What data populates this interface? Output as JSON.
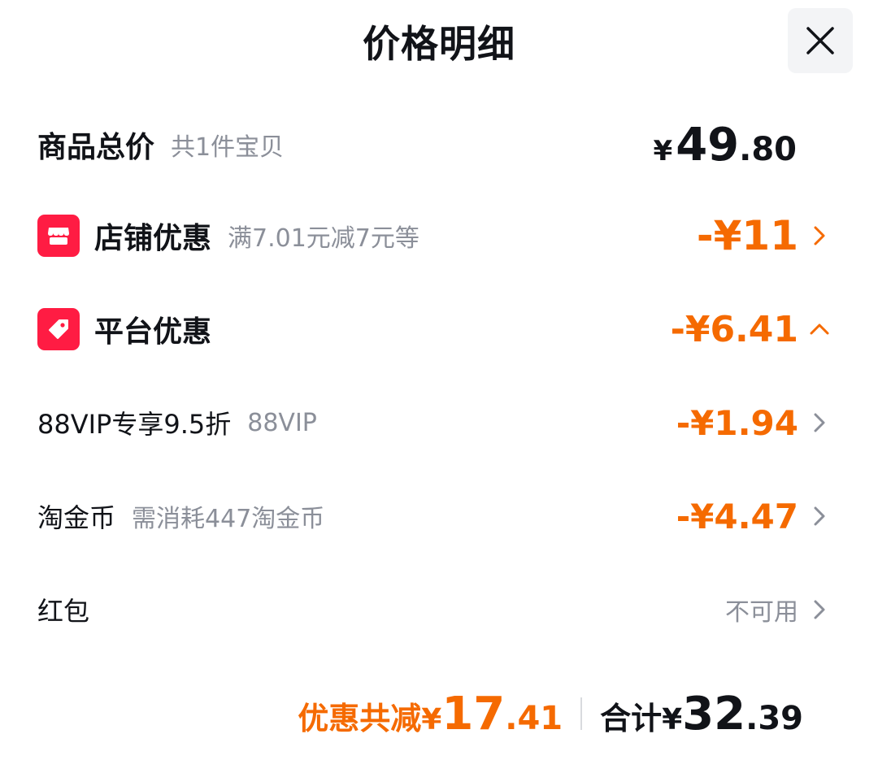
{
  "header": {
    "title": "价格明细",
    "close_icon": "close-icon"
  },
  "goods_total": {
    "label": "商品总价",
    "count_text": "共1件宝贝",
    "currency": "¥",
    "amount_int": "49",
    "amount_dec": ".80"
  },
  "store_discount": {
    "icon": "store-icon",
    "label": "店铺优惠",
    "detail": "满7.01元减7元等",
    "amount": "-¥11"
  },
  "platform_discount": {
    "icon": "tag-icon",
    "label": "平台优惠",
    "amount": "-¥6.41",
    "expanded": true
  },
  "vip": {
    "label": "88VIP专享9.5折",
    "detail": "88VIP",
    "amount": "-¥1.94"
  },
  "coins": {
    "label": "淘金币",
    "detail": "需消耗447淘金币",
    "amount": "-¥4.47"
  },
  "red_packet": {
    "label": "红包",
    "status": "不可用"
  },
  "summary": {
    "discount_label": "优惠共减",
    "discount_currency": "¥",
    "discount_int": "17",
    "discount_dec": ".41",
    "total_label": "合计",
    "total_currency": "¥",
    "total_int": "32",
    "total_dec": ".39"
  },
  "colors": {
    "accent_orange": "#f56a00",
    "badge_red": "#ff1c43",
    "text_dark": "#111318",
    "text_gray": "#8b8f99"
  }
}
